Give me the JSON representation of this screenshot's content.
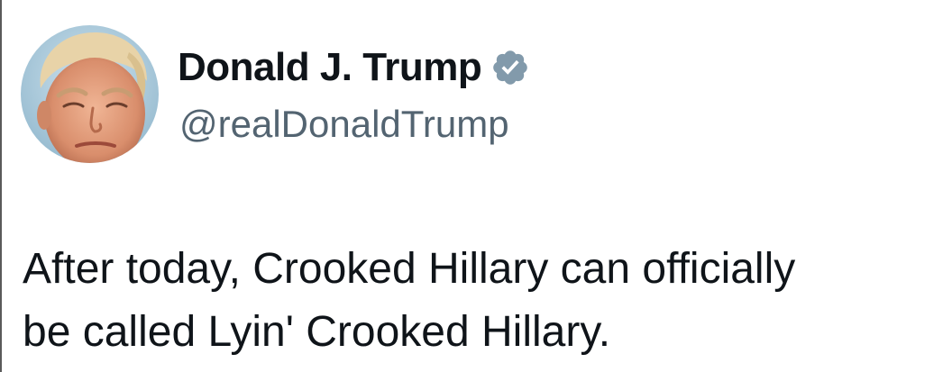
{
  "tweet": {
    "author": {
      "display_name": "Donald J. Trump",
      "handle": "@realDonaldTrump",
      "verified": true,
      "verified_icon": "verified-badge-icon",
      "verified_color": "#829aab"
    },
    "text_lines": [
      "After today, Crooked Hillary can officially",
      "be called Lyin' Crooked Hillary."
    ]
  },
  "colors": {
    "text": "#0f1419",
    "handle": "#536471",
    "background": "#ffffff"
  }
}
